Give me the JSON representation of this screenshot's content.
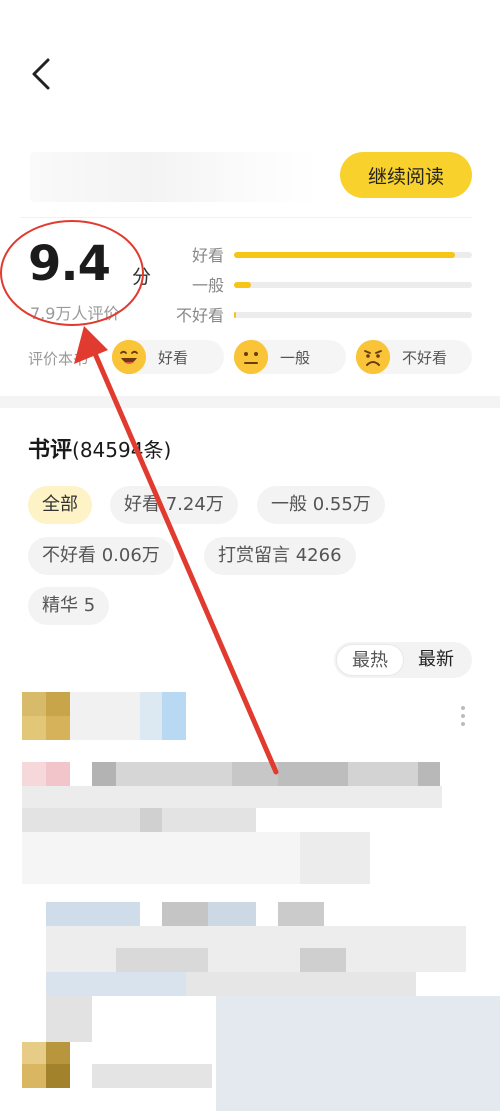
{
  "header": {
    "back_icon": "chevron-left-icon",
    "continue_label": "继续阅读"
  },
  "rating": {
    "score": "9.4",
    "unit": "分",
    "count_text": "7.9万人评价",
    "breakdown": [
      {
        "label": "好看",
        "fraction": 0.93
      },
      {
        "label": "一般",
        "fraction": 0.07
      },
      {
        "label": "不好看",
        "fraction": 0.01
      }
    ]
  },
  "evaluate": {
    "label": "评价本书",
    "options": [
      {
        "label": "好看",
        "icon": "laughing-face-icon"
      },
      {
        "label": "一般",
        "icon": "neutral-face-icon"
      },
      {
        "label": "不好看",
        "icon": "sad-face-icon"
      }
    ]
  },
  "reviews": {
    "title": "书评",
    "count": "(84594条)",
    "filters": [
      {
        "label": "全部",
        "active": true
      },
      {
        "label": "好看 7.24万",
        "active": false
      },
      {
        "label": "一般 0.55万",
        "active": false
      },
      {
        "label": "不好看 0.06万",
        "active": false
      },
      {
        "label": "打赏留言 4266",
        "active": false
      },
      {
        "label": "精华 5",
        "active": false
      }
    ],
    "sort": {
      "hot": "最热",
      "new": "最新"
    }
  },
  "colors": {
    "accent": "#f8d12c",
    "bar_fill": "#f5c518",
    "annotation": "#e03b2e"
  }
}
